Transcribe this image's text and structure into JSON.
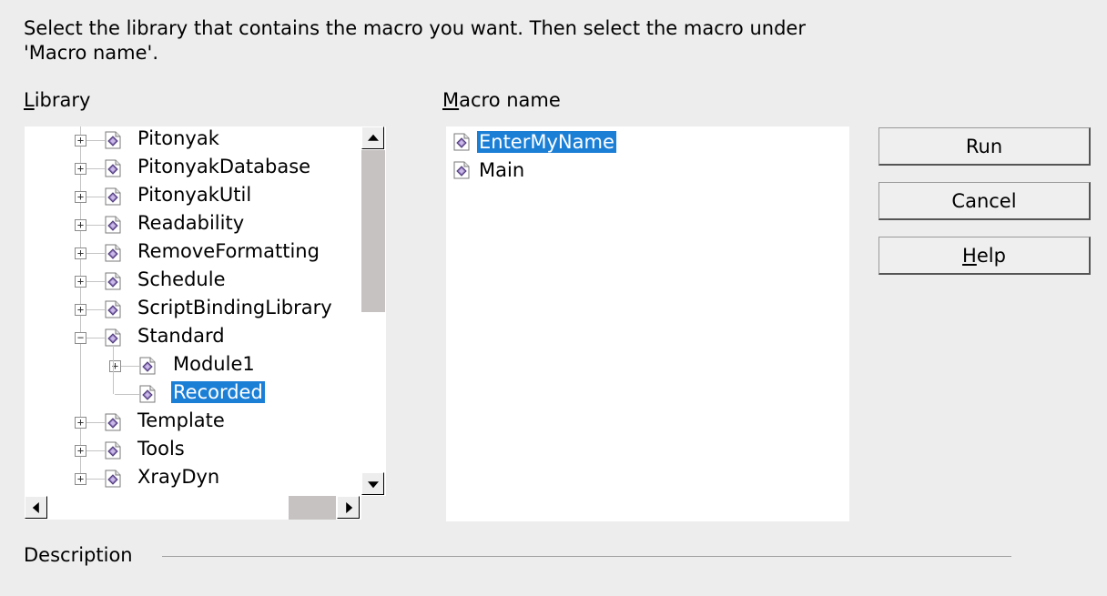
{
  "instructions": "Select the library that contains the macro you want. Then select the macro under 'Macro name'.",
  "library_label": {
    "mnemonic": "L",
    "rest": "ibrary"
  },
  "macro_label": {
    "mnemonic": "M",
    "rest": "acro name"
  },
  "library_tree": [
    {
      "label": "Pitonyak",
      "level": 0,
      "expander": "+",
      "selected": false
    },
    {
      "label": "PitonyakDatabase",
      "level": 0,
      "expander": "+",
      "selected": false
    },
    {
      "label": "PitonyakUtil",
      "level": 0,
      "expander": "+",
      "selected": false
    },
    {
      "label": "Readability",
      "level": 0,
      "expander": "+",
      "selected": false
    },
    {
      "label": "RemoveFormatting",
      "level": 0,
      "expander": "+",
      "selected": false
    },
    {
      "label": "Schedule",
      "level": 0,
      "expander": "+",
      "selected": false
    },
    {
      "label": "ScriptBindingLibrary",
      "level": 0,
      "expander": "+",
      "selected": false
    },
    {
      "label": "Standard",
      "level": 0,
      "expander": "−",
      "selected": false
    },
    {
      "label": "Module1",
      "level": 1,
      "expander": "+",
      "selected": false
    },
    {
      "label": "Recorded",
      "level": 1,
      "expander": "",
      "selected": true
    },
    {
      "label": "Template",
      "level": 0,
      "expander": "+",
      "selected": false
    },
    {
      "label": "Tools",
      "level": 0,
      "expander": "+",
      "selected": false
    },
    {
      "label": "XrayDyn",
      "level": 0,
      "expander": "+",
      "selected": false
    }
  ],
  "macro_list": [
    {
      "label": "EnterMyName",
      "selected": true
    },
    {
      "label": "Main",
      "selected": false
    }
  ],
  "buttons": {
    "run": {
      "label": "Run"
    },
    "cancel": {
      "label": "Cancel"
    },
    "help": {
      "mnemonic": "H",
      "rest": "elp"
    }
  },
  "description_label": "Description",
  "icons": {
    "library": "macro-library-icon",
    "expand": "expand-icon",
    "collapse": "collapse-icon"
  },
  "colors": {
    "selection": "#1c7fd6",
    "dialog_bg": "#ededed"
  }
}
